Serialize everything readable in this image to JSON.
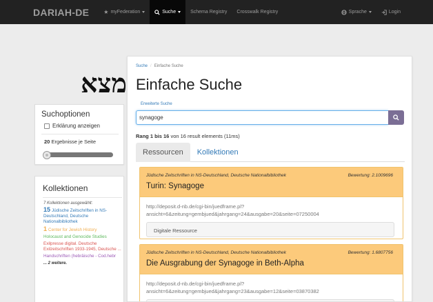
{
  "navbar": {
    "brand": "DARIAH-DE",
    "items": [
      {
        "icon": "star-icon",
        "glyph": "★",
        "label": "myFederation",
        "dropdown": true,
        "active": false
      },
      {
        "icon": "search-icon",
        "glyph": "⚲",
        "label": "Suche",
        "dropdown": true,
        "active": true
      },
      {
        "icon": "",
        "glyph": "",
        "label": "Schema Registry",
        "dropdown": false,
        "active": false
      },
      {
        "icon": "",
        "glyph": "",
        "label": "Crosswalk Registry",
        "dropdown": false,
        "active": false
      }
    ],
    "language": {
      "icon": "globe-icon",
      "glyph": "⊕",
      "label": "Sprache"
    },
    "login": {
      "icon": "login-icon",
      "glyph": "⇥",
      "label": "Login"
    }
  },
  "logo_text": "מצא",
  "options": {
    "title": "Suchoptionen",
    "explain_label": "Erklärung anzeigen",
    "per_page_count": "20",
    "per_page_label": "Ergebnisse je Seite"
  },
  "collections": {
    "title": "Kollektionen",
    "selected_label": "7 Kollektionen ausgewählt:",
    "entries": [
      {
        "count": "15",
        "name": "Jüdische Zeitschriften in NS-Deutschland, Deutsche Nationalbibliothek",
        "color": "#337ab7"
      },
      {
        "count": "1",
        "name": "Center for Jewish History",
        "color": "#f0ad4e"
      },
      {
        "count": "",
        "name": "Holocaust and Genocide Studies",
        "color": "#5cb85c"
      },
      {
        "count": "",
        "name": "Exilpresse digital. Deutsche Exilzeitschriften 1933-1945, Deutsche ...",
        "color": "#d9534f"
      },
      {
        "count": "",
        "name": "Handschriften (hebräische - Cod.hebr",
        "color": "#9b59b6"
      }
    ],
    "more_label": "... 2 weitere."
  },
  "breadcrumb": {
    "parent": "Suche",
    "current": "Einfache Suche"
  },
  "page_title": "Einfache Suche",
  "advanced_search_label": "Erweiterte Suche",
  "search": {
    "value": "synagoge"
  },
  "result_info": {
    "range": "Rang 1 bis 16",
    "rest": "von 16 result elements (11ms)"
  },
  "tabs": [
    {
      "label": "Ressourcen",
      "active": true
    },
    {
      "label": "Kollektionen",
      "active": false
    }
  ],
  "results": [
    {
      "collection": "Jüdische Zeitschriften in NS-Deutschland, Deutsche Nationalbibliothek",
      "score": "Bewertung: 2.1009696",
      "title": "Turin: Synagoge",
      "url": "http://deposit.d-nb.de/cgi-bin/juedframe.pl?ansicht=6&zeitung=gembjued&jahrgang=24&ausgabe=20&seite=07250004",
      "type": "Digitale Ressource"
    },
    {
      "collection": "Jüdische Zeitschriften in NS-Deutschland, Deutsche Nationalbibliothek",
      "score": "Bewertung: 1.6807756",
      "title": "Die Ausgrabung der Synagoge in Beth-Alpha",
      "url": "http://deposit.d-nb.de/cgi-bin/juedframe.pl?ansicht=6&zeitung=gembjued&jahrgang=23&ausgabe=12&seite=03870382",
      "type": ""
    }
  ]
}
